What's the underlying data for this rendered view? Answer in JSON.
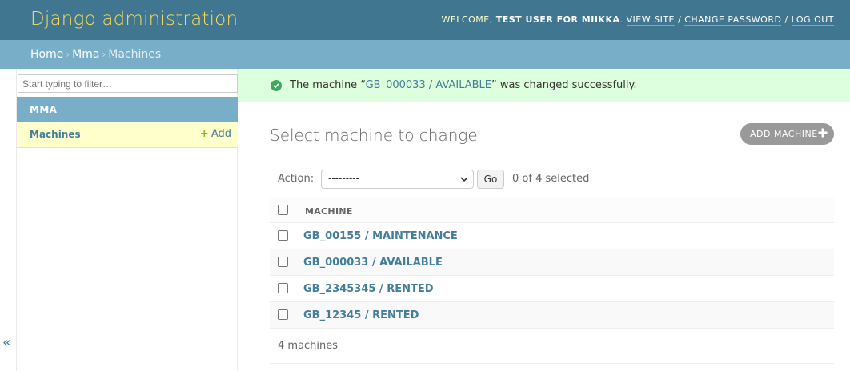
{
  "header": {
    "site_name": "Django administration",
    "welcome": "WELCOME,",
    "user_name": "TEST USER FOR MIIKKA",
    "view_site": "VIEW SITE",
    "change_password": "CHANGE PASSWORD",
    "log_out": "LOG OUT"
  },
  "breadcrumbs": {
    "home": "Home",
    "app": "Mma",
    "current": "Machines"
  },
  "sidebar": {
    "filter_placeholder": "Start typing to filter…",
    "app_name": "MMA",
    "model_name": "Machines",
    "add_label": "Add",
    "toggle_icon": "«"
  },
  "message": {
    "prefix": "The machine “",
    "link": "GB_000033 / AVAILABLE",
    "suffix": "” was changed successfully."
  },
  "main": {
    "title": "Select machine to change",
    "add_button": "ADD MACHINE",
    "action_label": "Action:",
    "action_selected": "---------",
    "go_label": "Go",
    "selected_count": "0 of 4 selected",
    "column_header": "MACHINE",
    "rows": [
      "GB_00155 / MAINTENANCE",
      "GB_000033 / AVAILABLE",
      "GB_2345345 / RENTED",
      "GB_12345 / RENTED"
    ],
    "paginator": "4 machines"
  },
  "colors": {
    "header_bg": "#417690",
    "site_name": "#f5dd5d",
    "breadcrumb_bg": "#79aec8",
    "success_bg": "#ddffdd",
    "link": "#447e9b",
    "add_green": "#70bf2b"
  }
}
